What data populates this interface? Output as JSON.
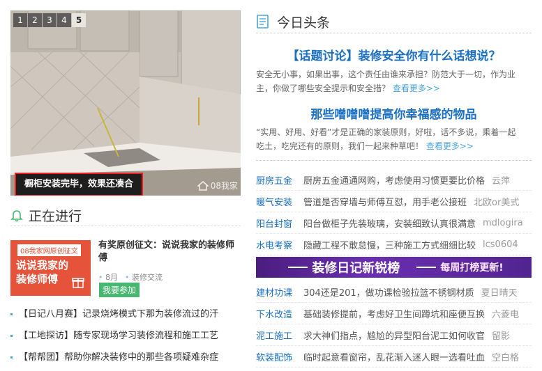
{
  "slider": {
    "pages": [
      "1",
      "2",
      "3",
      "4",
      "5"
    ],
    "active_page": "5",
    "caption": "橱柜安装完毕，效果还凑合",
    "watermark": "08我家"
  },
  "ongoing": {
    "title": "正在进行",
    "promo_image": {
      "tag": "08我家网原创征文",
      "line1": "说说我家的",
      "line2": "装修师傅"
    },
    "promo_title": "有奖原创征文：说说我家的装修师傅",
    "meta_month": "8月",
    "meta_category": "装修交流",
    "join_label": "我要参加",
    "list": [
      "【日记八月赛】记录烧烤模式下那为装修流过的汗",
      "【工地探访】随专家现场学习装修流程和施工工艺",
      "【帮帮团】帮助你解决装修中的那些各项疑难杂症"
    ]
  },
  "headlines": {
    "title": "今日头条",
    "h1": "【话题讨论】装修安全你有什么话想说？",
    "d1": "安全无小事，如果出事，这个责任由谁来承担？防范大于一切，作为业主，你做了哪些安全提示和安全措？",
    "d1_more": "查看更多>>",
    "h2": "那些噌噌噌提高你幸福感的物品",
    "d2": "“实用、好用、好看”才是正确的家装原则，好啦，话不多说，乘着一起吃土，吃完还有的原则，我们一起来种草吧！",
    "d2_more": "查看更多>>"
  },
  "rows_top": [
    {
      "cat": "厨房五金",
      "text": "厨房五金通通网购，考虑使用习惯更要比价格",
      "user": "云萍"
    },
    {
      "cat": "暖气安装",
      "text": "管道是否穿墙与师傅互怼，用手老公接班",
      "user": "北欧or美式"
    },
    {
      "cat": "阳台封窗",
      "text": "阳台做柜子先装玻璃，安装细致认真很满意",
      "user": "mdlogira"
    },
    {
      "cat": "水电考察",
      "text": "隐藏工程不敢怠慢，三种施工方式细细比较",
      "user": "lcs0604"
    }
  ],
  "banner": {
    "main": "装修日记新锐榜",
    "sub": "每周打榜更新!"
  },
  "rows_bottom": [
    {
      "cat": "建材功课",
      "text": "304还是201，做功课检验拉篮不锈钢材质",
      "user": "夏日晴天"
    },
    {
      "cat": "下水改造",
      "text": "基础装修提前，考虑好卫生间蹲坑和座便互换",
      "user": "六菱电"
    },
    {
      "cat": "泥工施工",
      "text": "求大神们指点，尴尬的异型阳台泥工如何收官",
      "user": "留影"
    },
    {
      "cat": "软装配饰",
      "text": "临时起意看窗帘，乱花渐入迷人眼一选看吐血",
      "user": "空白格"
    }
  ],
  "colors": {
    "link_blue": "#1a6fc2",
    "accent_red": "#e8201f",
    "promo_orange": "#e4533a",
    "green": "#46b870",
    "banner_purple": "#5a2598"
  },
  "icons": [
    "news-doc-icon",
    "bell-icon",
    "gift-icon"
  ]
}
